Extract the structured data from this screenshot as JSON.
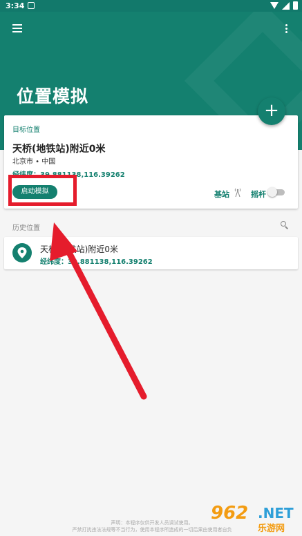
{
  "status_bar": {
    "time": "3:34"
  },
  "app": {
    "title": "位置模拟"
  },
  "current_location": {
    "section_label": "目标位置",
    "place": "天桥(地铁站)附近0米",
    "region": "北京市 • 中国",
    "coords": "经纬度：39.881138,116.39262",
    "start_button": "启动模拟",
    "basestation_label": "基站",
    "joystick_label": "摇杆",
    "joystick_enabled": false
  },
  "history": {
    "section_label": "历史位置",
    "items": [
      {
        "title": "天桥(地铁站)附近0米",
        "coords": "经纬度：39.881138,116.39262"
      }
    ]
  },
  "footer": {
    "line1": "声明：本程序仅供开发人员调试使用。",
    "line2": "严禁打扰违法法规等不当行为，使用本程序所造成的一切后果由使用者自负"
  },
  "watermark": {
    "number": "962",
    "net": ".NET",
    "cn": "乐游网"
  },
  "colors": {
    "primary": "#14806f",
    "status_bar": "#12796b",
    "annotation": "#e51c2c"
  }
}
